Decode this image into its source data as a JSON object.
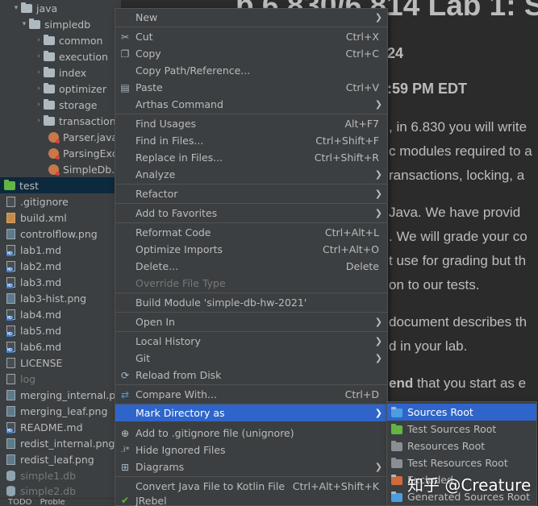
{
  "tree": {
    "items": [
      {
        "label": "java"
      },
      {
        "label": "simpledb"
      },
      {
        "label": "common"
      },
      {
        "label": "execution"
      },
      {
        "label": "index"
      },
      {
        "label": "optimizer"
      },
      {
        "label": "storage"
      },
      {
        "label": "transaction"
      },
      {
        "label": "Parser.java"
      },
      {
        "label": "ParsingExce"
      },
      {
        "label": "SimpleDb.ja"
      },
      {
        "label": "test"
      },
      {
        "label": ".gitignore"
      },
      {
        "label": "build.xml"
      },
      {
        "label": "controlflow.png"
      },
      {
        "label": "lab1.md"
      },
      {
        "label": "lab2.md"
      },
      {
        "label": "lab3.md"
      },
      {
        "label": "lab3-hist.png"
      },
      {
        "label": "lab4.md"
      },
      {
        "label": "lab5.md"
      },
      {
        "label": "lab6.md"
      },
      {
        "label": "LICENSE"
      },
      {
        "label": "log"
      },
      {
        "label": "merging_internal.png"
      },
      {
        "label": "merging_leaf.png"
      },
      {
        "label": "README.md"
      },
      {
        "label": "redist_internal.png"
      },
      {
        "label": "redist_leaf.png"
      },
      {
        "label": "simple1.db"
      },
      {
        "label": "simple2.db"
      }
    ],
    "bottom_tabs": [
      "TODO",
      "Proble"
    ]
  },
  "doc": {
    "title": "b 6.830/6.814 Lab 1: S",
    "line_date": "24",
    "line_time": ":59 PM EDT",
    "p1": ", in 6.830 you will write",
    "p2": "c modules required to a",
    "p3": "ransactions, locking, a",
    "p4": "Java. We have provid",
    "p5": ". We will grade your co",
    "p6": "t use for grading but th",
    "p7": "on to our tests.",
    "p8": "document describes th",
    "p9": "d in your lab.",
    "p10_bold": "end",
    "p10_rest": " that you start as e"
  },
  "menu": {
    "items": [
      {
        "label": "New",
        "shortcut": "",
        "icon": ""
      },
      {
        "label": "Cut",
        "shortcut": "Ctrl+X",
        "icon": "scissors-icon"
      },
      {
        "label": "Copy",
        "shortcut": "Ctrl+C",
        "icon": "copy-icon"
      },
      {
        "label": "Copy Path/Reference...",
        "shortcut": ""
      },
      {
        "label": "Paste",
        "shortcut": "Ctrl+V",
        "icon": "paste-icon"
      },
      {
        "label": "Arthas Command",
        "shortcut": ""
      },
      {
        "label": "Find Usages",
        "shortcut": "Alt+F7"
      },
      {
        "label": "Find in Files...",
        "shortcut": "Ctrl+Shift+F"
      },
      {
        "label": "Replace in Files...",
        "shortcut": "Ctrl+Shift+R"
      },
      {
        "label": "Analyze",
        "shortcut": ""
      },
      {
        "label": "Refactor",
        "shortcut": ""
      },
      {
        "label": "Add to Favorites",
        "shortcut": ""
      },
      {
        "label": "Reformat Code",
        "shortcut": "Ctrl+Alt+L"
      },
      {
        "label": "Optimize Imports",
        "shortcut": "Ctrl+Alt+O"
      },
      {
        "label": "Delete...",
        "shortcut": "Delete"
      },
      {
        "label": "Override File Type",
        "shortcut": ""
      },
      {
        "label": "Build Module 'simple-db-hw-2021'",
        "shortcut": ""
      },
      {
        "label": "Open In",
        "shortcut": ""
      },
      {
        "label": "Local History",
        "shortcut": ""
      },
      {
        "label": "Git",
        "shortcut": ""
      },
      {
        "label": "Reload from Disk",
        "shortcut": "",
        "icon": "reload-icon"
      },
      {
        "label": "Compare With...",
        "shortcut": "Ctrl+D",
        "icon": "compare-icon"
      },
      {
        "label": "Mark Directory as",
        "shortcut": ""
      },
      {
        "label": "Add to .gitignore file (unignore)",
        "shortcut": "",
        "icon": "gitignore-icon"
      },
      {
        "label": "Hide Ignored Files",
        "shortcut": "",
        "icon": "hide-ignored-icon"
      },
      {
        "label": "Diagrams",
        "shortcut": "",
        "icon": "diagram-icon"
      },
      {
        "label": "Convert Java File to Kotlin File",
        "shortcut": "Ctrl+Alt+Shift+K"
      },
      {
        "label": "JRebel",
        "shortcut": "",
        "icon": "jrebel-icon"
      }
    ]
  },
  "submenu": {
    "items": [
      {
        "label": "Sources Root"
      },
      {
        "label": "Test Sources Root"
      },
      {
        "label": "Resources Root"
      },
      {
        "label": "Test Resources Root"
      },
      {
        "label": "Excluded"
      },
      {
        "label": "Generated Sources Root"
      }
    ]
  },
  "watermark": "知乎 @Creature",
  "colors": {
    "selection": "#2f65ca",
    "menu_bg": "#3c3f41",
    "editor_bg": "#2b2b2b",
    "source_folder": "#62b543"
  }
}
